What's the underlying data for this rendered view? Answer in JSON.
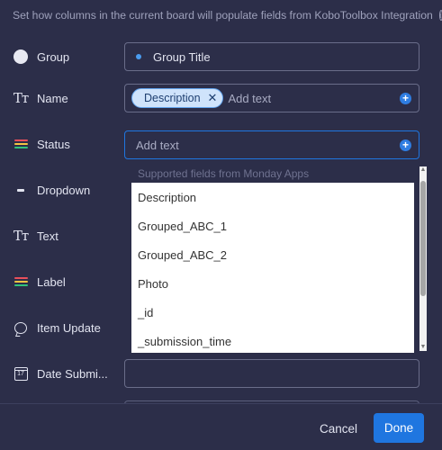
{
  "header": {
    "text": "Set how columns in the current board will populate fields from KoboToolbox Integration",
    "info_icon": "info-icon"
  },
  "colors": {
    "background": "#2c2e49",
    "accent": "#1f76e0",
    "chip_bg": "#cfe3fb",
    "status_stripes": [
      "#e8505b",
      "#f6c343",
      "#32c37a"
    ]
  },
  "rows": [
    {
      "label": "Group",
      "icon": "circle-icon",
      "value": "Group Title",
      "placeholder": ""
    },
    {
      "label": "Name",
      "icon": "text-type-icon",
      "chip": "Description",
      "placeholder": "Add text"
    },
    {
      "label": "Status",
      "icon": "status-icon",
      "placeholder": "Add text"
    },
    {
      "label": "Dropdown",
      "icon": "dropdown-icon"
    },
    {
      "label": "Text",
      "icon": "text-type-icon"
    },
    {
      "label": "Label",
      "icon": "label-icon"
    },
    {
      "label": "Item Update",
      "icon": "speech-bubble-icon"
    },
    {
      "label": "Date Submi...",
      "icon": "calendar-icon",
      "calendar_day": "17",
      "value": ""
    }
  ],
  "dropdown": {
    "heading": "Supported fields from Monday Apps",
    "items": [
      "Description",
      "Grouped_ABC_1",
      "Grouped_ABC_2",
      "Photo",
      "_id",
      "_submission_time"
    ]
  },
  "footer": {
    "cancel_label": "Cancel",
    "done_label": "Done"
  }
}
